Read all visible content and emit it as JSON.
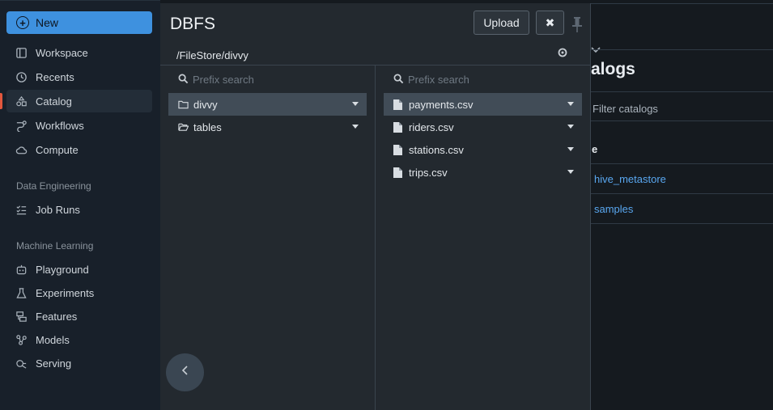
{
  "sidebar": {
    "new_label": "New",
    "items": [
      {
        "label": "Workspace",
        "icon": "workspace-icon"
      },
      {
        "label": "Recents",
        "icon": "clock-icon"
      },
      {
        "label": "Catalog",
        "icon": "catalog-icon"
      },
      {
        "label": "Workflows",
        "icon": "workflows-icon"
      },
      {
        "label": "Compute",
        "icon": "cloud-icon"
      }
    ],
    "section_data_engineering": "Data Engineering",
    "job_runs": "Job Runs",
    "section_ml": "Machine Learning",
    "ml_items": [
      {
        "label": "Playground",
        "icon": "robot-icon"
      },
      {
        "label": "Experiments",
        "icon": "flask-icon"
      },
      {
        "label": "Features",
        "icon": "features-icon"
      },
      {
        "label": "Models",
        "icon": "models-icon"
      },
      {
        "label": "Serving",
        "icon": "serving-icon"
      }
    ],
    "active_color": "#e2573d",
    "new_button_color": "#3e91df"
  },
  "dbfs": {
    "title": "DBFS",
    "upload_label": "Upload",
    "close_label": "✖",
    "path": "/FileStore/divvy",
    "left_search_placeholder": "Prefix search",
    "right_search_placeholder": "Prefix search",
    "folders": [
      {
        "name": "divvy",
        "selected": true
      },
      {
        "name": "tables",
        "selected": false
      }
    ],
    "files": [
      {
        "name": "payments.csv",
        "selected": true
      },
      {
        "name": "riders.csv",
        "selected": false
      },
      {
        "name": "stations.csv",
        "selected": false
      },
      {
        "name": "trips.csv",
        "selected": false
      }
    ]
  },
  "catalog_page": {
    "title_fragment": "alogs",
    "filter_fragment": "Filter catalogs",
    "column_fragment": "e",
    "catalogs": [
      "hive_metastore",
      "samples"
    ],
    "link_color": "#59a7f0"
  }
}
